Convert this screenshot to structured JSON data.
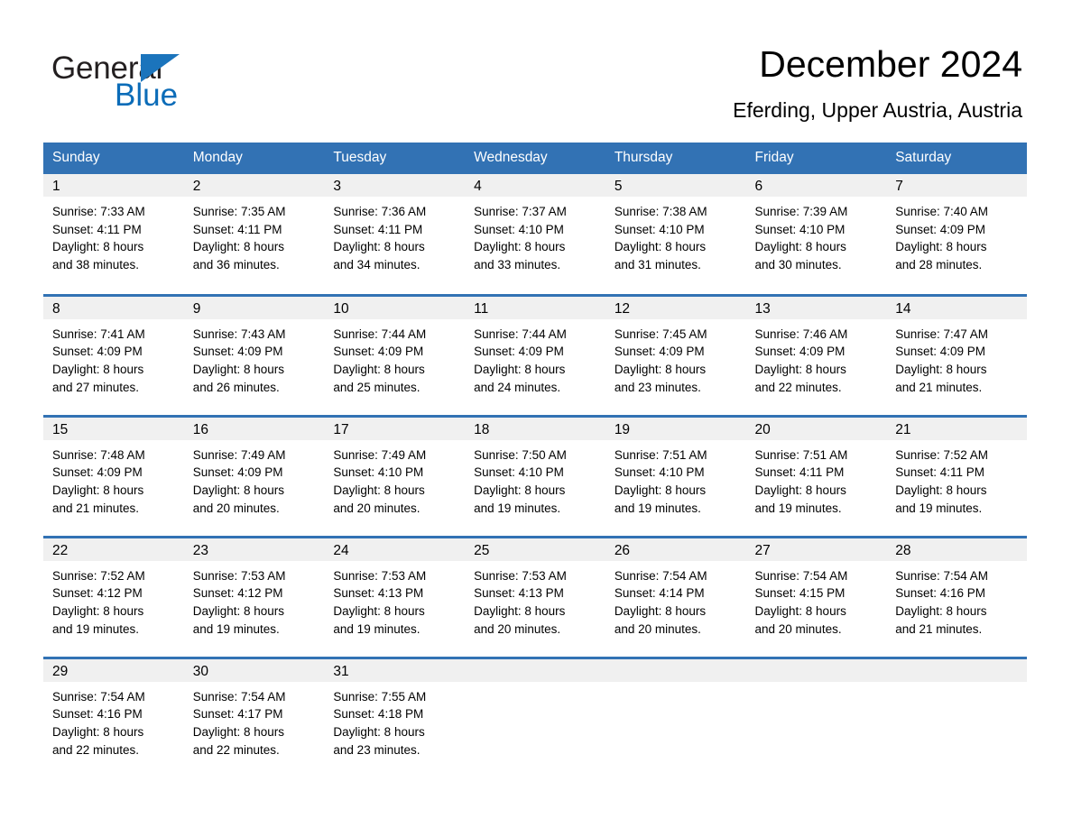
{
  "brand": {
    "name_part1": "General",
    "name_part2": "Blue",
    "triangle_color": "#1b74bc",
    "blue_text_color": "#0b6cb8"
  },
  "header": {
    "title": "December 2024",
    "subtitle": "Eferding, Upper Austria, Austria"
  },
  "theme": {
    "header_blue": "#3272b4",
    "daynum_bg": "#f0f0f0",
    "row_rule": "#3272b4"
  },
  "calendar": {
    "weekday_headers": [
      "Sunday",
      "Monday",
      "Tuesday",
      "Wednesday",
      "Thursday",
      "Friday",
      "Saturday"
    ],
    "weeks": [
      [
        {
          "day": "1",
          "sunrise": "Sunrise: 7:33 AM",
          "sunset": "Sunset: 4:11 PM",
          "daylight_line1": "Daylight: 8 hours",
          "daylight_line2": "and 38 minutes."
        },
        {
          "day": "2",
          "sunrise": "Sunrise: 7:35 AM",
          "sunset": "Sunset: 4:11 PM",
          "daylight_line1": "Daylight: 8 hours",
          "daylight_line2": "and 36 minutes."
        },
        {
          "day": "3",
          "sunrise": "Sunrise: 7:36 AM",
          "sunset": "Sunset: 4:11 PM",
          "daylight_line1": "Daylight: 8 hours",
          "daylight_line2": "and 34 minutes."
        },
        {
          "day": "4",
          "sunrise": "Sunrise: 7:37 AM",
          "sunset": "Sunset: 4:10 PM",
          "daylight_line1": "Daylight: 8 hours",
          "daylight_line2": "and 33 minutes."
        },
        {
          "day": "5",
          "sunrise": "Sunrise: 7:38 AM",
          "sunset": "Sunset: 4:10 PM",
          "daylight_line1": "Daylight: 8 hours",
          "daylight_line2": "and 31 minutes."
        },
        {
          "day": "6",
          "sunrise": "Sunrise: 7:39 AM",
          "sunset": "Sunset: 4:10 PM",
          "daylight_line1": "Daylight: 8 hours",
          "daylight_line2": "and 30 minutes."
        },
        {
          "day": "7",
          "sunrise": "Sunrise: 7:40 AM",
          "sunset": "Sunset: 4:09 PM",
          "daylight_line1": "Daylight: 8 hours",
          "daylight_line2": "and 28 minutes."
        }
      ],
      [
        {
          "day": "8",
          "sunrise": "Sunrise: 7:41 AM",
          "sunset": "Sunset: 4:09 PM",
          "daylight_line1": "Daylight: 8 hours",
          "daylight_line2": "and 27 minutes."
        },
        {
          "day": "9",
          "sunrise": "Sunrise: 7:43 AM",
          "sunset": "Sunset: 4:09 PM",
          "daylight_line1": "Daylight: 8 hours",
          "daylight_line2": "and 26 minutes."
        },
        {
          "day": "10",
          "sunrise": "Sunrise: 7:44 AM",
          "sunset": "Sunset: 4:09 PM",
          "daylight_line1": "Daylight: 8 hours",
          "daylight_line2": "and 25 minutes."
        },
        {
          "day": "11",
          "sunrise": "Sunrise: 7:44 AM",
          "sunset": "Sunset: 4:09 PM",
          "daylight_line1": "Daylight: 8 hours",
          "daylight_line2": "and 24 minutes."
        },
        {
          "day": "12",
          "sunrise": "Sunrise: 7:45 AM",
          "sunset": "Sunset: 4:09 PM",
          "daylight_line1": "Daylight: 8 hours",
          "daylight_line2": "and 23 minutes."
        },
        {
          "day": "13",
          "sunrise": "Sunrise: 7:46 AM",
          "sunset": "Sunset: 4:09 PM",
          "daylight_line1": "Daylight: 8 hours",
          "daylight_line2": "and 22 minutes."
        },
        {
          "day": "14",
          "sunrise": "Sunrise: 7:47 AM",
          "sunset": "Sunset: 4:09 PM",
          "daylight_line1": "Daylight: 8 hours",
          "daylight_line2": "and 21 minutes."
        }
      ],
      [
        {
          "day": "15",
          "sunrise": "Sunrise: 7:48 AM",
          "sunset": "Sunset: 4:09 PM",
          "daylight_line1": "Daylight: 8 hours",
          "daylight_line2": "and 21 minutes."
        },
        {
          "day": "16",
          "sunrise": "Sunrise: 7:49 AM",
          "sunset": "Sunset: 4:09 PM",
          "daylight_line1": "Daylight: 8 hours",
          "daylight_line2": "and 20 minutes."
        },
        {
          "day": "17",
          "sunrise": "Sunrise: 7:49 AM",
          "sunset": "Sunset: 4:10 PM",
          "daylight_line1": "Daylight: 8 hours",
          "daylight_line2": "and 20 minutes."
        },
        {
          "day": "18",
          "sunrise": "Sunrise: 7:50 AM",
          "sunset": "Sunset: 4:10 PM",
          "daylight_line1": "Daylight: 8 hours",
          "daylight_line2": "and 19 minutes."
        },
        {
          "day": "19",
          "sunrise": "Sunrise: 7:51 AM",
          "sunset": "Sunset: 4:10 PM",
          "daylight_line1": "Daylight: 8 hours",
          "daylight_line2": "and 19 minutes."
        },
        {
          "day": "20",
          "sunrise": "Sunrise: 7:51 AM",
          "sunset": "Sunset: 4:11 PM",
          "daylight_line1": "Daylight: 8 hours",
          "daylight_line2": "and 19 minutes."
        },
        {
          "day": "21",
          "sunrise": "Sunrise: 7:52 AM",
          "sunset": "Sunset: 4:11 PM",
          "daylight_line1": "Daylight: 8 hours",
          "daylight_line2": "and 19 minutes."
        }
      ],
      [
        {
          "day": "22",
          "sunrise": "Sunrise: 7:52 AM",
          "sunset": "Sunset: 4:12 PM",
          "daylight_line1": "Daylight: 8 hours",
          "daylight_line2": "and 19 minutes."
        },
        {
          "day": "23",
          "sunrise": "Sunrise: 7:53 AM",
          "sunset": "Sunset: 4:12 PM",
          "daylight_line1": "Daylight: 8 hours",
          "daylight_line2": "and 19 minutes."
        },
        {
          "day": "24",
          "sunrise": "Sunrise: 7:53 AM",
          "sunset": "Sunset: 4:13 PM",
          "daylight_line1": "Daylight: 8 hours",
          "daylight_line2": "and 19 minutes."
        },
        {
          "day": "25",
          "sunrise": "Sunrise: 7:53 AM",
          "sunset": "Sunset: 4:13 PM",
          "daylight_line1": "Daylight: 8 hours",
          "daylight_line2": "and 20 minutes."
        },
        {
          "day": "26",
          "sunrise": "Sunrise: 7:54 AM",
          "sunset": "Sunset: 4:14 PM",
          "daylight_line1": "Daylight: 8 hours",
          "daylight_line2": "and 20 minutes."
        },
        {
          "day": "27",
          "sunrise": "Sunrise: 7:54 AM",
          "sunset": "Sunset: 4:15 PM",
          "daylight_line1": "Daylight: 8 hours",
          "daylight_line2": "and 20 minutes."
        },
        {
          "day": "28",
          "sunrise": "Sunrise: 7:54 AM",
          "sunset": "Sunset: 4:16 PM",
          "daylight_line1": "Daylight: 8 hours",
          "daylight_line2": "and 21 minutes."
        }
      ],
      [
        {
          "day": "29",
          "sunrise": "Sunrise: 7:54 AM",
          "sunset": "Sunset: 4:16 PM",
          "daylight_line1": "Daylight: 8 hours",
          "daylight_line2": "and 22 minutes."
        },
        {
          "day": "30",
          "sunrise": "Sunrise: 7:54 AM",
          "sunset": "Sunset: 4:17 PM",
          "daylight_line1": "Daylight: 8 hours",
          "daylight_line2": "and 22 minutes."
        },
        {
          "day": "31",
          "sunrise": "Sunrise: 7:55 AM",
          "sunset": "Sunset: 4:18 PM",
          "daylight_line1": "Daylight: 8 hours",
          "daylight_line2": "and 23 minutes."
        },
        {
          "day": "",
          "sunrise": "",
          "sunset": "",
          "daylight_line1": "",
          "daylight_line2": ""
        },
        {
          "day": "",
          "sunrise": "",
          "sunset": "",
          "daylight_line1": "",
          "daylight_line2": ""
        },
        {
          "day": "",
          "sunrise": "",
          "sunset": "",
          "daylight_line1": "",
          "daylight_line2": ""
        },
        {
          "day": "",
          "sunrise": "",
          "sunset": "",
          "daylight_line1": "",
          "daylight_line2": ""
        }
      ]
    ]
  }
}
